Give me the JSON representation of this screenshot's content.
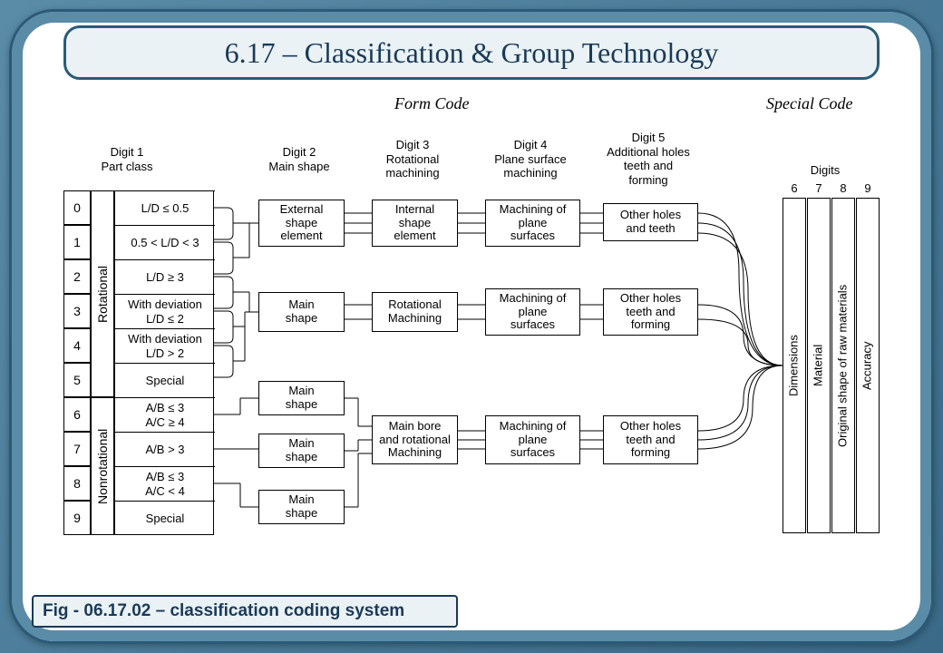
{
  "title": "6.17 – Classification & Group Technology",
  "caption": "Fig - 06.17.02 – classification coding system",
  "section_labels": {
    "form_code": "Form Code",
    "special_code": "Special Code"
  },
  "columns": {
    "c1": {
      "line1": "Digit 1",
      "line2": "Part class"
    },
    "c2": {
      "line1": "Digit 2",
      "line2": "Main shape"
    },
    "c3": {
      "line1": "Digit 3",
      "line2": "Rotational",
      "line3": "machining"
    },
    "c4": {
      "line1": "Digit 4",
      "line2": "Plane surface",
      "line3": "machining"
    },
    "c5": {
      "line1": "Digit 5",
      "line2": "Additional holes",
      "line3": "teeth and",
      "line4": "forming"
    },
    "c6": {
      "line1": "Digits"
    }
  },
  "digits": [
    "0",
    "1",
    "2",
    "3",
    "4",
    "5",
    "6",
    "7",
    "8",
    "9"
  ],
  "rot_labels": {
    "rotational": "Rotational",
    "nonrotational": "Nonrotational"
  },
  "part_descs": [
    "L/D ≤ 0.5",
    "0.5 < L/D < 3",
    "L/D ≥ 3",
    "With deviation\nL/D ≤ 2",
    "With deviation\nL/D > 2",
    "Special",
    "A/B ≤ 3\nA/C ≥ 4",
    "A/B > 3",
    "A/B ≤ 3\nA/C < 4",
    "Special"
  ],
  "flow": {
    "d2": [
      "External\nshape\nelement",
      "Main\nshape",
      "Main\nshape",
      "Main\nshape",
      "Main\nshape"
    ],
    "d3": [
      "Internal\nshape\nelement",
      "Rotational\nMachining",
      "Main bore\nand rotational\nMachining"
    ],
    "d4": [
      "Machining of\nplane\nsurfaces",
      "Machining of\nplane\nsurfaces",
      "Machining of\nplane\nsurfaces"
    ],
    "d5": [
      "Other holes\nand teeth",
      "Other holes\nteeth and\nforming",
      "Other holes\nteeth and\nforming"
    ]
  },
  "special_digits": [
    "6",
    "7",
    "8",
    "9"
  ],
  "special_labels": [
    "Dimensions",
    "Material",
    "Original shape of raw materials",
    "Accuracy"
  ]
}
